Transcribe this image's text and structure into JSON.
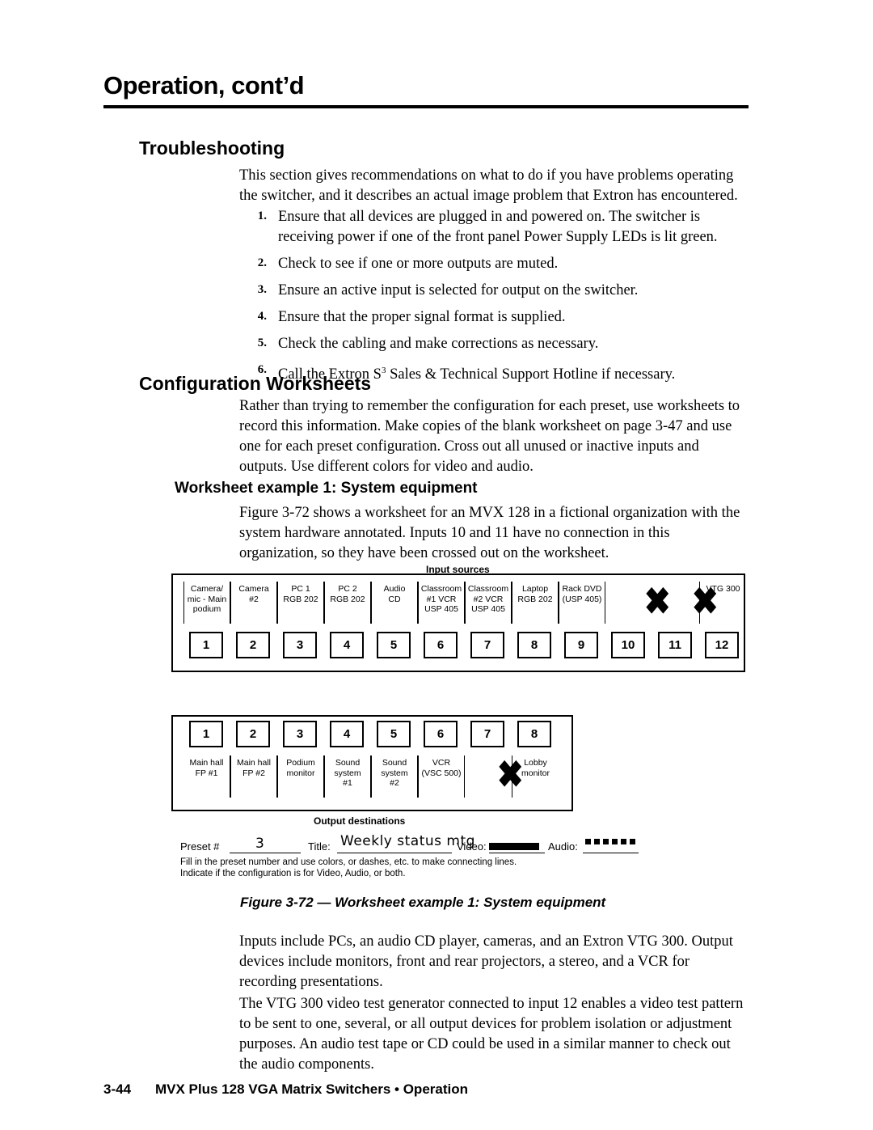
{
  "header": {
    "chapter_title": "Operation, cont’d"
  },
  "sections": {
    "troubleshooting": {
      "heading": "Troubleshooting",
      "intro": "This section gives recommendations on what to do if you have problems operating the switcher, and it describes an actual image problem that Extron has encountered.",
      "steps": [
        {
          "num": "1.",
          "text": "Ensure that all devices are plugged in and powered on.  The switcher is receiving power if one of the front panel Power Supply LEDs is lit green."
        },
        {
          "num": "2.",
          "text": "Check to see if one or more outputs are muted."
        },
        {
          "num": "3.",
          "text": "Ensure an active input is selected for output on the switcher."
        },
        {
          "num": "4.",
          "text": "Ensure that the proper signal format is supplied."
        },
        {
          "num": "5.",
          "text": "Check the cabling and make corrections as necessary."
        },
        {
          "num": "6.",
          "text": "Call the Extron S3 Sales & Technical Support Hotline if necessary."
        }
      ]
    },
    "configuration_worksheets": {
      "heading": "Configuration Worksheets",
      "intro": "Rather than trying to remember the configuration for each preset, use worksheets to record this information.  Make copies of the blank worksheet on page 3-47 and use one for each preset configuration.  Cross out all unused or inactive inputs and outputs.  Use different colors for video and audio.",
      "subheading": "Worksheet example 1: System equipment",
      "sub_intro": "Figure 3-72 shows a worksheet for an MVX 128 in a fictional organization with the system hardware annotated.  Inputs 10 and 11 have no connection in this organization, so they have been crossed out on the worksheet.",
      "after_1": "Inputs include PCs, an audio CD player, cameras, and an Extron VTG 300.  Output devices include monitors, front and rear projectors, a stereo, and a VCR for recording presentations.",
      "after_2": "The VTG 300 video test generator connected to input 12 enables a video test pattern to be sent to one, several, or all output devices for problem isolation or adjustment purposes.  An audio test tape or CD could be used in a similar manner to check out the audio components."
    }
  },
  "worksheet": {
    "input_title": "Input  sources",
    "output_title": "Output destinations",
    "input_labels": [
      "Camera/\nmic - Main\npodium",
      "Camera\n#2",
      "PC 1\nRGB 202",
      "PC 2\nRGB 202",
      "Audio\nCD",
      "Classroom\n#1 VCR\nUSP 405",
      "Classroom\n#2 VCR\nUSP 405",
      "Laptop\nRGB 202",
      "Rack DVD\n(USP 405)",
      "",
      "",
      "VTG 300"
    ],
    "input_numbers": [
      "1",
      "2",
      "3",
      "4",
      "5",
      "6",
      "7",
      "8",
      "9",
      "10",
      "11",
      "12"
    ],
    "input_crossed": [
      10,
      11
    ],
    "output_numbers": [
      "1",
      "2",
      "3",
      "4",
      "5",
      "6",
      "7",
      "8"
    ],
    "output_labels": [
      "Main hall\nFP #1",
      "Main hall\nFP #2",
      "Podium\nmonitor",
      "Sound\nsystem\n#1",
      "Sound\nsystem\n#2",
      "VCR\n(VSC 500)",
      "",
      "Lobby\nmonitor"
    ],
    "output_crossed": [
      7
    ],
    "preset_label": "Preset #",
    "preset_value": "3",
    "title_label": "Title:",
    "title_value": "Weekly status mtg",
    "video_label": "Video:",
    "audio_label": "Audio:",
    "fineprint_1": "Fill in the preset number and use colors, or dashes, etc. to make connecting lines.",
    "fineprint_2": "Indicate if the configuration is for Video, Audio, or both.",
    "figure_caption": "Figure 3-72 — Worksheet example 1: System equipment"
  },
  "footer": {
    "page_number": "3-44",
    "text": "MVX Plus 128 VGA Matrix Switchers • Operation"
  }
}
